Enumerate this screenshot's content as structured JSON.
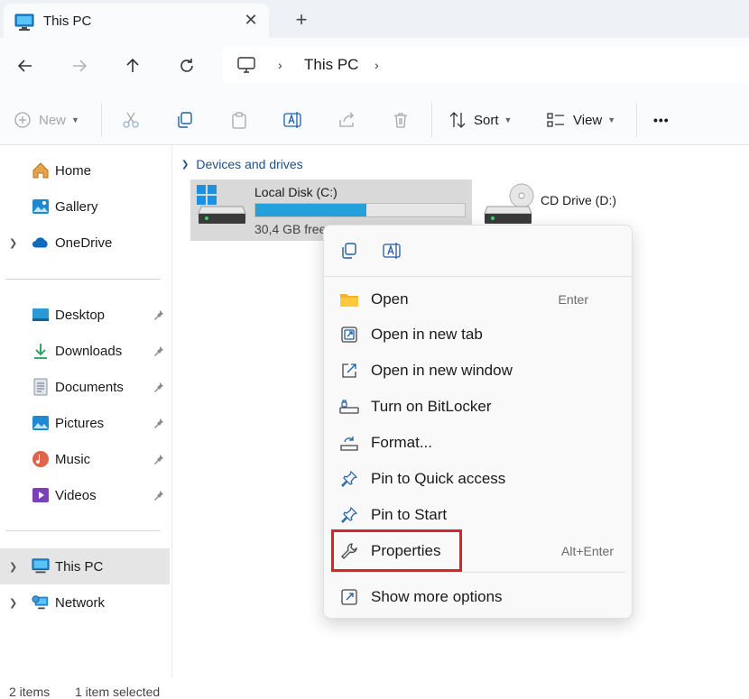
{
  "tab": {
    "title": "This PC",
    "close": "✕",
    "new_tab": "+"
  },
  "address": {
    "crumb": "This PC",
    "chevron": "›"
  },
  "toolbar": {
    "new_label": "New",
    "sort_label": "Sort",
    "view_label": "View",
    "more_label": "•••"
  },
  "sidebar": {
    "items": [
      {
        "label": "Home",
        "icon": "home-icon"
      },
      {
        "label": "Gallery",
        "icon": "gallery-icon"
      },
      {
        "label": "OneDrive",
        "icon": "cloud-icon"
      },
      {
        "label": "Desktop",
        "icon": "desktop-icon"
      },
      {
        "label": "Downloads",
        "icon": "download-icon"
      },
      {
        "label": "Documents",
        "icon": "documents-icon"
      },
      {
        "label": "Pictures",
        "icon": "pictures-icon"
      },
      {
        "label": "Music",
        "icon": "music-icon"
      },
      {
        "label": "Videos",
        "icon": "videos-icon"
      },
      {
        "label": "This PC",
        "icon": "pc-icon"
      },
      {
        "label": "Network",
        "icon": "network-icon"
      }
    ]
  },
  "main": {
    "group_label": "Devices and drives",
    "drives": [
      {
        "name": "Local Disk (C:)",
        "free": "30,4 GB free",
        "used_fraction": 0.53
      },
      {
        "name": "CD Drive (D:)"
      }
    ]
  },
  "context_menu": {
    "items": [
      {
        "label": "Open",
        "shortcut": "Enter"
      },
      {
        "label": "Open in new tab",
        "shortcut": ""
      },
      {
        "label": "Open in new window",
        "shortcut": ""
      },
      {
        "label": "Turn on BitLocker",
        "shortcut": ""
      },
      {
        "label": "Format...",
        "shortcut": ""
      },
      {
        "label": "Pin to Quick access",
        "shortcut": ""
      },
      {
        "label": "Pin to Start",
        "shortcut": ""
      },
      {
        "label": "Properties",
        "shortcut": "Alt+Enter"
      },
      {
        "label": "Show more options",
        "shortcut": ""
      }
    ]
  },
  "status": {
    "item_count": "2 items",
    "selection": "1 item selected"
  },
  "colors": {
    "accent": "#26a0da",
    "highlight_box": "#d9232d",
    "selected_bg": "#e5e5e5"
  }
}
